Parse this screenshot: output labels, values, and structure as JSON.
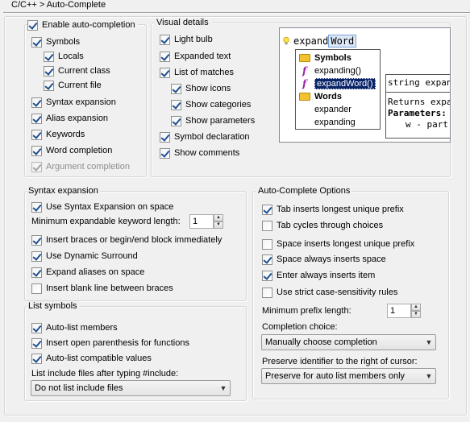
{
  "page": {
    "breadcrumb": "C/C++ > Auto-Complete"
  },
  "general": {
    "enable": {
      "label": "Enable auto-completion",
      "checked": true
    },
    "items": [
      {
        "label": "Symbols",
        "checked": true
      },
      {
        "label": "Locals",
        "checked": true
      },
      {
        "label": "Current class",
        "checked": true
      },
      {
        "label": "Current file",
        "checked": true
      },
      {
        "label": "Syntax expansion",
        "checked": true
      },
      {
        "label": "Alias expansion",
        "checked": true
      },
      {
        "label": "Keywords",
        "checked": true
      },
      {
        "label": "Word completion",
        "checked": true
      },
      {
        "label": "Argument completion",
        "checked": true
      }
    ]
  },
  "visual": {
    "title": "Visual details",
    "items": [
      {
        "label": "Light bulb",
        "checked": true
      },
      {
        "label": "Expanded text",
        "checked": true
      },
      {
        "label": "List of matches",
        "checked": true
      },
      {
        "label": "Show icons",
        "checked": true
      },
      {
        "label": "Show categories",
        "checked": true
      },
      {
        "label": "Show parameters",
        "checked": true
      },
      {
        "label": "Symbol declaration",
        "checked": true
      },
      {
        "label": "Show comments",
        "checked": true
      }
    ],
    "preview": {
      "typed": "expand",
      "completion": "Word",
      "list": [
        {
          "text": "Symbols",
          "kind": "category"
        },
        {
          "text": "expanding()",
          "kind": "function"
        },
        {
          "text": "expandWord()",
          "kind": "function-selected"
        },
        {
          "text": "Words",
          "kind": "category"
        },
        {
          "text": "expander",
          "kind": "word"
        },
        {
          "text": "expanding",
          "kind": "word"
        }
      ],
      "tip_decl": "string expan",
      "tip_returns": "Returns expa",
      "tip_params": "Parameters:",
      "tip_param_w": "w - part"
    }
  },
  "syntax": {
    "title": "Syntax expansion",
    "use": {
      "label": "Use Syntax Expansion on space",
      "checked": true
    },
    "min_length_label": "Minimum expandable keyword length:",
    "min_length_value": "1",
    "items": [
      {
        "label": "Insert braces or begin/end block immediately",
        "checked": true
      },
      {
        "label": "Use Dynamic Surround",
        "checked": true
      },
      {
        "label": "Expand aliases on space",
        "checked": true
      },
      {
        "label": "Insert blank line between braces",
        "checked": false
      }
    ]
  },
  "listsym": {
    "title": "List symbols",
    "items": [
      {
        "label": "Auto-list members",
        "checked": true
      },
      {
        "label": "Insert open parenthesis for functions",
        "checked": true
      },
      {
        "label": "Auto-list compatible values",
        "checked": true
      }
    ],
    "include_label": "List include files after typing #include:",
    "include_value": "Do not list include files"
  },
  "options": {
    "title": "Auto-Complete Options",
    "items": [
      {
        "label": "Tab inserts longest unique prefix",
        "checked": true
      },
      {
        "label": "Tab cycles through choices",
        "checked": false
      },
      {
        "label": "Space inserts longest unique prefix",
        "checked": false
      },
      {
        "label": "Space always inserts space",
        "checked": true
      },
      {
        "label": "Enter always inserts item",
        "checked": true
      },
      {
        "label": "Use strict case-sensitivity rules",
        "checked": false
      }
    ],
    "min_prefix_label": "Minimum prefix length:",
    "min_prefix_value": "1",
    "choice_label": "Completion choice:",
    "choice_value": "Manually choose completion",
    "preserve_label": "Preserve identifier to the right of cursor:",
    "preserve_value": "Preserve for auto list members only"
  },
  "colors": {
    "check": "#1d4f91",
    "selection": "#0a246a",
    "function_icon": "#9a1fa8",
    "folder_icon": "#f1c232"
  }
}
